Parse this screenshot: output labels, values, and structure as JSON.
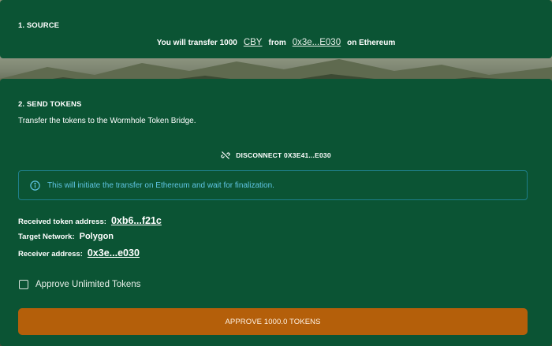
{
  "source": {
    "title": "1. SOURCE",
    "prefix": "You will transfer 1000",
    "token": "CBY",
    "from_label": "from",
    "address": "0x3e...E030",
    "suffix": "on Ethereum"
  },
  "send": {
    "title": "2. SEND TOKENS",
    "subtitle": "Transfer the tokens to the Wormhole Token Bridge.",
    "disconnect_label": "DISCONNECT 0X3E41...E030",
    "info": "This will initiate the transfer on Ethereum and wait for finalization.",
    "details": {
      "received_label": "Received token address:",
      "received_value": "0xb6...f21c",
      "network_label": "Target Network:",
      "network_value": "Polygon",
      "receiver_label": "Receiver address:",
      "receiver_value": "0x3e...e030"
    },
    "approve_unlimited_label": "Approve Unlimited Tokens",
    "approve_unlimited_checked": false,
    "approve_button": "APPROVE 1000.0 TOKENS"
  },
  "colors": {
    "card": "#0b5434",
    "info": "#5fc5e3",
    "button": "#b45f0a"
  },
  "icons": {
    "disconnect": "link-off-icon",
    "info": "info-icon",
    "checkbox": "checkbox-icon"
  }
}
